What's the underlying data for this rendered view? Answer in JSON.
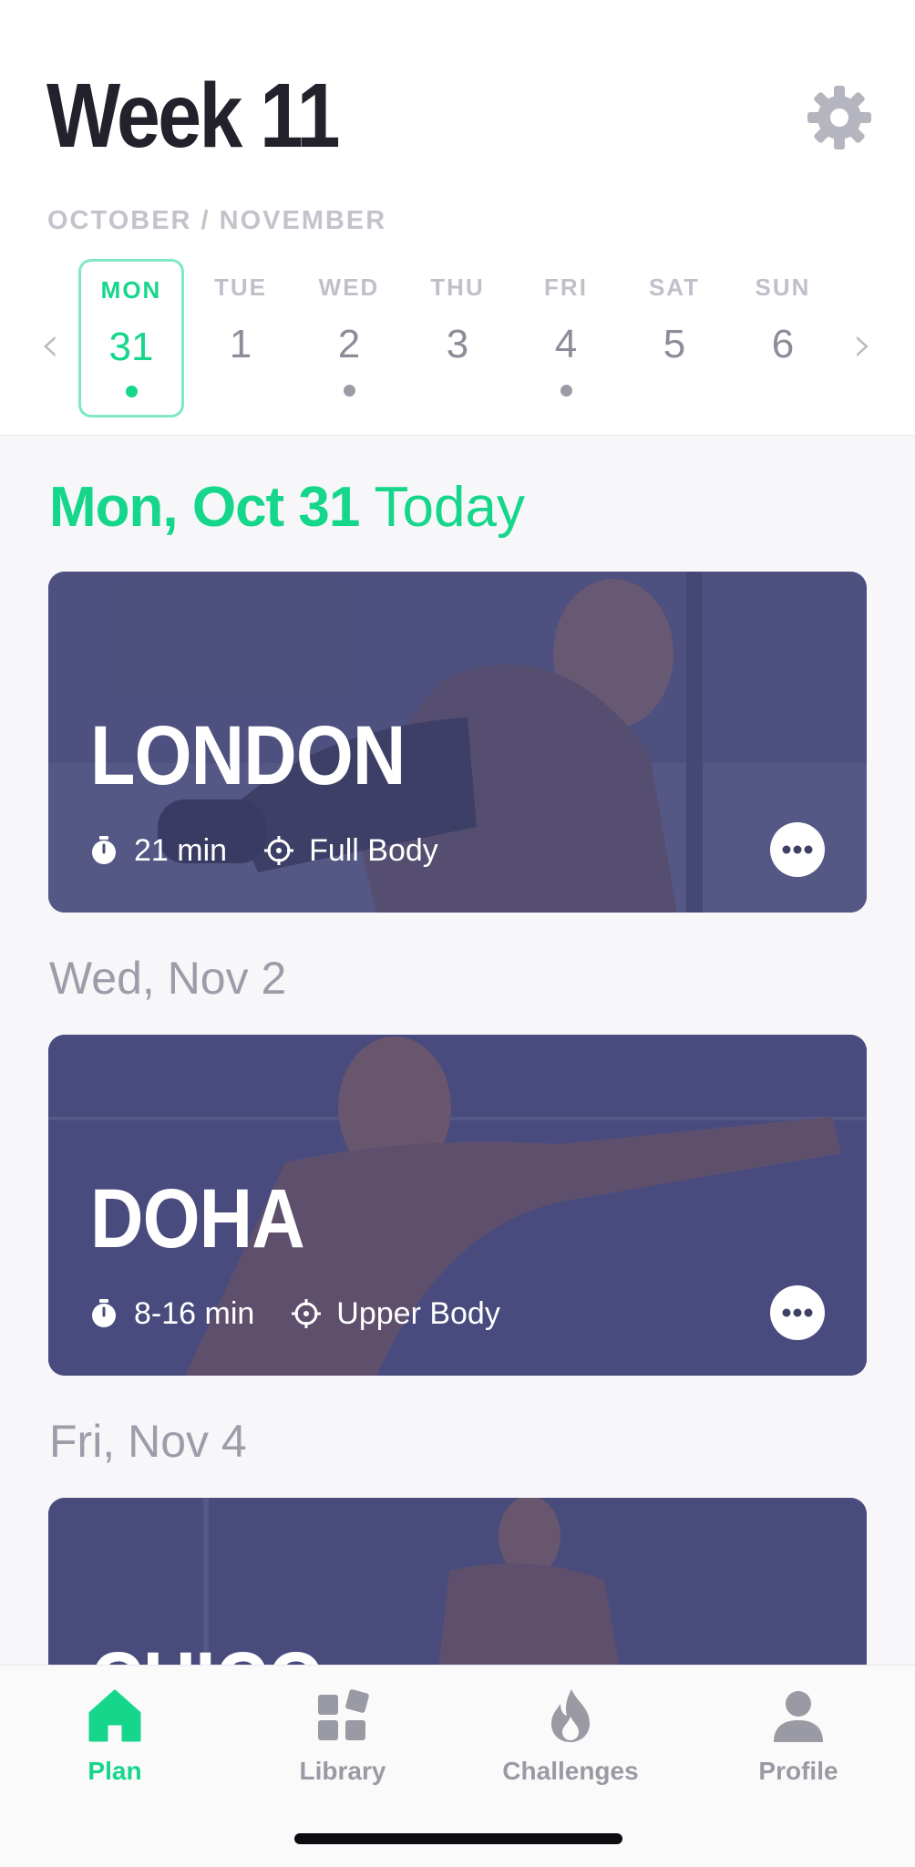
{
  "header": {
    "title": "Week 11",
    "month_range": "OCTOBER / NOVEMBER",
    "prev_arrow": "‹",
    "next_arrow": "›"
  },
  "week": [
    {
      "name": "MON",
      "num": "31",
      "selected": true,
      "has_workout": true
    },
    {
      "name": "TUE",
      "num": "1",
      "selected": false,
      "has_workout": false
    },
    {
      "name": "WED",
      "num": "2",
      "selected": false,
      "has_workout": true
    },
    {
      "name": "THU",
      "num": "3",
      "selected": false,
      "has_workout": false
    },
    {
      "name": "FRI",
      "num": "4",
      "selected": false,
      "has_workout": true
    },
    {
      "name": "SAT",
      "num": "5",
      "selected": false,
      "has_workout": false
    },
    {
      "name": "SUN",
      "num": "6",
      "selected": false,
      "has_workout": false
    }
  ],
  "feed": [
    {
      "date": "Mon, Oct 31",
      "today_label": "Today",
      "workout": {
        "name": "LONDON",
        "duration": "21 min",
        "focus": "Full Body"
      }
    },
    {
      "date": "Wed, Nov 2",
      "workout": {
        "name": "DOHA",
        "duration": "8-16 min",
        "focus": "Upper Body"
      }
    },
    {
      "date": "Fri, Nov 4",
      "workout": {
        "name": "CHICO",
        "duration": "",
        "focus": ""
      }
    }
  ],
  "tabbar": {
    "tabs": [
      {
        "label": "Plan",
        "icon": "home-icon",
        "active": true
      },
      {
        "label": "Library",
        "icon": "library-icon",
        "active": false
      },
      {
        "label": "Challenges",
        "icon": "flame-icon",
        "active": false
      },
      {
        "label": "Profile",
        "icon": "person-icon",
        "active": false
      }
    ]
  },
  "colors": {
    "accent": "#15d68a",
    "title": "#23222c",
    "muted": "#9d9daa",
    "card": "#4a4b74"
  }
}
